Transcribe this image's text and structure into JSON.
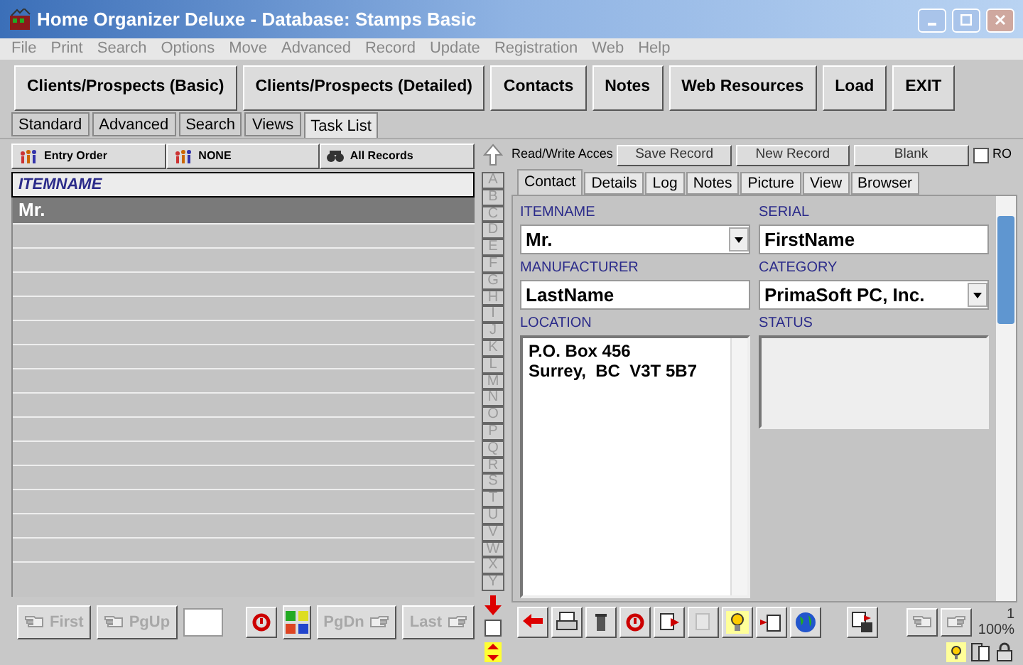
{
  "window": {
    "title": "Home Organizer Deluxe - Database: Stamps Basic"
  },
  "menu": [
    "File",
    "Print",
    "Search",
    "Options",
    "Move",
    "Advanced",
    "Record",
    "Update",
    "Registration",
    "Web",
    "Help"
  ],
  "module_buttons": [
    "Clients/Prospects (Basic)",
    "Clients/Prospects (Detailed)",
    "Contacts",
    "Notes",
    "Web Resources",
    "Load",
    "EXIT"
  ],
  "view_tabs": [
    {
      "label": "Standard",
      "selected": false
    },
    {
      "label": "Advanced",
      "selected": false
    },
    {
      "label": "Search",
      "selected": false
    },
    {
      "label": "Views",
      "selected": false
    },
    {
      "label": "Task List",
      "selected": true
    }
  ],
  "list_header": {
    "sort": "Entry Order",
    "filter": "NONE",
    "scope": "All Records"
  },
  "list": {
    "column": "ITEMNAME",
    "rows": [
      {
        "value": "Mr.",
        "selected": true
      }
    ]
  },
  "side_checkbox": {
    "checked": false
  },
  "alphabet": [
    "A",
    "B",
    "C",
    "D",
    "E",
    "F",
    "G",
    "H",
    "I",
    "J",
    "K",
    "L",
    "M",
    "N",
    "O",
    "P",
    "Q",
    "R",
    "S",
    "T",
    "U",
    "V",
    "W",
    "X",
    "Y"
  ],
  "record_bar": {
    "access": "Read/Write Acces",
    "buttons": [
      "Save Record",
      "New Record",
      "Blank"
    ],
    "ro": {
      "label": "RO",
      "checked": false
    }
  },
  "record_tabs": [
    {
      "label": "Contact",
      "selected": true
    },
    {
      "label": "Details",
      "selected": false
    },
    {
      "label": "Log",
      "selected": false
    },
    {
      "label": "Notes",
      "selected": false
    },
    {
      "label": "Picture",
      "selected": false
    },
    {
      "label": "View",
      "selected": false
    },
    {
      "label": "Browser",
      "selected": false
    }
  ],
  "fields": [
    {
      "label": "ITEMNAME",
      "kind": "dropdown",
      "value": "Mr."
    },
    {
      "label": "SERIAL",
      "kind": "text",
      "value": "FirstName"
    },
    {
      "label": "MANUFACTURER",
      "kind": "text",
      "value": "LastName"
    },
    {
      "label": "CATEGORY",
      "kind": "dropdown",
      "value": "PrimaSoft PC, Inc."
    },
    {
      "label": "LOCATION",
      "kind": "memo",
      "lines": [
        "P.O. Box 456",
        "Surrey,  BC  V3T 5B7"
      ]
    },
    {
      "label": "STATUS",
      "kind": "memo"
    }
  ],
  "navigation": [
    {
      "label": "First",
      "disabled": true
    },
    {
      "label": "PgUp",
      "disabled": true
    },
    {
      "label": "PgDn",
      "disabled": true
    },
    {
      "label": "Last",
      "disabled": true
    }
  ],
  "status": {
    "record": "1",
    "zoom": "100%"
  }
}
